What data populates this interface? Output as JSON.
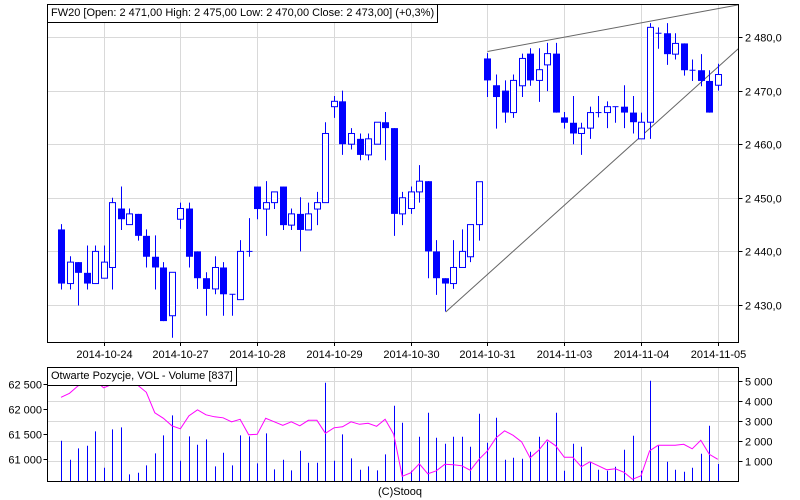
{
  "header": {
    "title": "FW20 [Open: 2 471,00  High: 2 475,00  Low: 2 470,00  Close: 2 473,00] (+0,3%)"
  },
  "volume_panel": {
    "title": "Otwarte Pozycje, VOL - Volume [837]"
  },
  "footer": {
    "copyright": "(C)Stooq"
  },
  "colors": {
    "candle": "#0000ff",
    "open_interest": "#ff00ff",
    "grid": "#d9d9d9",
    "trendline": "#666666"
  },
  "chart_data": [
    {
      "type": "candlestick",
      "title": "FW20",
      "y_axis": {
        "position": "right",
        "range": [
          2423,
          2486
        ],
        "ticks": [
          2430,
          2440,
          2450,
          2460,
          2470,
          2480
        ],
        "tick_labels": [
          "2 430,0",
          "2 440,0",
          "2 450,0",
          "2 460,0",
          "2 470,0",
          "2 480,0"
        ]
      },
      "x_axis": {
        "date_labels": [
          {
            "index": 5,
            "label": "2014-10-24"
          },
          {
            "index": 14,
            "label": "2014-10-27"
          },
          {
            "index": 23,
            "label": "2014-10-28"
          },
          {
            "index": 32,
            "label": "2014-10-29"
          },
          {
            "index": 41,
            "label": "2014-10-30"
          },
          {
            "index": 50,
            "label": "2014-10-31"
          },
          {
            "index": 59,
            "label": "2014-11-03"
          },
          {
            "index": 68,
            "label": "2014-11-04"
          },
          {
            "index": 77,
            "label": "2014-11-05"
          }
        ]
      },
      "grid": true,
      "ohlc_fields": [
        "open",
        "high",
        "low",
        "close"
      ],
      "ohlc": [
        [
          2444.1,
          2445.1,
          2432.9,
          2434
        ],
        [
          2434,
          2439.1,
          2432.9,
          2438
        ],
        [
          2438,
          2438,
          2429.9,
          2436
        ],
        [
          2436,
          2441.1,
          2432.9,
          2434
        ],
        [
          2434,
          2441.1,
          2434,
          2440
        ],
        [
          2435,
          2441.1,
          2435,
          2438
        ],
        [
          2437,
          2450,
          2432.9,
          2449.1
        ],
        [
          2448,
          2452.1,
          2444,
          2446
        ],
        [
          2445,
          2448,
          2445,
          2447
        ],
        [
          2447,
          2447,
          2442,
          2442.9
        ],
        [
          2442.9,
          2444.1,
          2437,
          2439
        ],
        [
          2439,
          2443,
          2432.9,
          2437
        ],
        [
          2437,
          2438,
          2427,
          2427
        ],
        [
          2428,
          2436.1,
          2423.9,
          2436.1
        ],
        [
          2446,
          2449.1,
          2444.2,
          2448
        ],
        [
          2448,
          2449.1,
          2437,
          2439
        ],
        [
          2440,
          2440,
          2433,
          2435
        ],
        [
          2435,
          2436.1,
          2428,
          2433
        ],
        [
          2433,
          2439.1,
          2432,
          2437
        ],
        [
          2437,
          2438,
          2428,
          2432
        ],
        [
          2432,
          2432,
          2428,
          2432
        ],
        [
          2431,
          2442.1,
          2431,
          2440
        ],
        [
          2440,
          2446.2,
          2439,
          2440
        ],
        [
          2452.1,
          2452.1,
          2446,
          2447.9
        ],
        [
          2447.9,
          2453.1,
          2442.9,
          2449.1
        ],
        [
          2449.1,
          2451.1,
          2447.9,
          2451.1
        ],
        [
          2452.1,
          2452.1,
          2444,
          2444.9
        ],
        [
          2444.9,
          2448,
          2444,
          2447
        ],
        [
          2447,
          2450.1,
          2440,
          2444
        ],
        [
          2444,
          2449.1,
          2444,
          2447
        ],
        [
          2447.9,
          2451.1,
          2444.9,
          2449.1
        ],
        [
          2449.1,
          2464.1,
          2449.1,
          2462
        ],
        [
          2467,
          2469,
          2464.9,
          2468
        ],
        [
          2468,
          2470,
          2458,
          2460
        ],
        [
          2460,
          2463,
          2459,
          2462
        ],
        [
          2461,
          2462,
          2457,
          2458
        ],
        [
          2458,
          2462,
          2457,
          2461
        ],
        [
          2460,
          2464.1,
          2460,
          2464.1
        ],
        [
          2464.1,
          2466,
          2457,
          2463
        ],
        [
          2463,
          2463,
          2442.9,
          2447
        ],
        [
          2447,
          2451.1,
          2444.9,
          2450
        ],
        [
          2448,
          2452.1,
          2447,
          2451.1
        ],
        [
          2451.1,
          2456.1,
          2449.1,
          2453.1
        ],
        [
          2453.1,
          2453.1,
          2435,
          2440
        ],
        [
          2440,
          2442.1,
          2431.9,
          2435
        ],
        [
          2435,
          2435,
          2428.8,
          2434
        ],
        [
          2434,
          2442.1,
          2433,
          2437
        ],
        [
          2437,
          2444.1,
          2437,
          2440
        ],
        [
          2439,
          2445,
          2438,
          2445
        ],
        [
          2445,
          2453,
          2442,
          2453
        ],
        [
          2476,
          2477,
          2468.8,
          2471.9
        ],
        [
          2471,
          2473,
          2462.9,
          2468.8
        ],
        [
          2470,
          2471.9,
          2464,
          2465.9
        ],
        [
          2465.9,
          2473,
          2464.9,
          2471.9
        ],
        [
          2470.9,
          2476.9,
          2468.8,
          2476
        ],
        [
          2476.9,
          2477.9,
          2470.9,
          2471.9
        ],
        [
          2471.9,
          2477.9,
          2467.9,
          2473.9
        ],
        [
          2474.8,
          2478.9,
          2469.9,
          2476.9
        ],
        [
          2476.9,
          2478.9,
          2465.9,
          2465.9
        ],
        [
          2465,
          2466,
          2462.9,
          2464
        ],
        [
          2464,
          2469,
          2460,
          2462
        ],
        [
          2462,
          2464,
          2458,
          2463
        ],
        [
          2463,
          2467,
          2461,
          2465.9
        ],
        [
          2465.9,
          2469,
          2465,
          2465.9
        ],
        [
          2465.9,
          2468,
          2463,
          2467
        ],
        [
          2467,
          2467,
          2464,
          2467
        ],
        [
          2467,
          2471,
          2463,
          2465.9
        ],
        [
          2465.9,
          2469,
          2462,
          2464.1
        ],
        [
          2461,
          2465.9,
          2461,
          2464.1
        ],
        [
          2464.1,
          2482.6,
          2461,
          2481.8
        ],
        [
          2480.7,
          2481.8,
          2477.8,
          2480.7
        ],
        [
          2480.7,
          2482.6,
          2474.8,
          2476.8
        ],
        [
          2476.8,
          2480.7,
          2475.8,
          2478.8
        ],
        [
          2478.8,
          2478.8,
          2472.8,
          2473.8
        ],
        [
          2473.8,
          2475.8,
          2471.8,
          2473.8
        ],
        [
          2473.8,
          2476.8,
          2470.8,
          2471.8
        ],
        [
          2471.8,
          2473.8,
          2465.9,
          2465.9
        ],
        [
          2471,
          2475,
          2470,
          2473
        ]
      ],
      "trendlines": [
        {
          "name": "upper-trendline",
          "from": [
            50,
            2477.3
          ],
          "to": [
            79.4,
            2486
          ]
        },
        {
          "name": "lower-trendline",
          "from": [
            45.1,
            2428.7
          ],
          "to": [
            79.4,
            2477.8
          ]
        }
      ]
    },
    {
      "type": "bar+line",
      "title": "Otwarte Pozycje, VOL - Volume [837]",
      "volume_axis": {
        "position": "right",
        "range": [
          0,
          5200
        ],
        "ticks": [
          1000,
          2000,
          3000,
          4000,
          5000
        ],
        "tick_labels": [
          "1 000",
          "2 000",
          "3 000",
          "4 000",
          "5 000"
        ]
      },
      "open_interest_axis": {
        "position": "left",
        "ticks": [
          61000,
          61500,
          62000,
          62500
        ],
        "tick_labels": [
          "61 000",
          "61 500",
          "62 000",
          "62 500"
        ]
      },
      "volume": [
        2000,
        1050,
        1617,
        1750,
        2467,
        650,
        2567,
        2667,
        317,
        400,
        767,
        1367,
        2267,
        3267,
        1000,
        2217,
        1800,
        2067,
        717,
        1400,
        767,
        2267,
        2217,
        867,
        2367,
        567,
        1050,
        517,
        1500,
        900,
        900,
        4900,
        1000,
        2317,
        1117,
        550,
        717,
        517,
        1317,
        3750,
        2900,
        500,
        2200,
        3400,
        2150,
        1850,
        2200,
        2200,
        1700,
        3350,
        1900,
        3150,
        1050,
        1150,
        1100,
        1450,
        2200,
        1950,
        3400,
        500,
        1850,
        1700,
        950,
        550,
        500,
        700,
        1550,
        2250,
        500,
        5000,
        1750,
        950,
        550,
        450,
        650,
        1350,
        2750,
        837
      ],
      "open_interest": [
        62240,
        62320,
        62470,
        62500,
        62570,
        62430,
        62500,
        62480,
        62500,
        62480,
        62340,
        61930,
        61820,
        61670,
        61610,
        61870,
        61990,
        61890,
        61850,
        61830,
        61750,
        61800,
        61490,
        61500,
        61820,
        61750,
        61680,
        61750,
        61670,
        61780,
        61780,
        61520,
        61630,
        61650,
        61750,
        61700,
        61720,
        61660,
        61800,
        61500,
        60660,
        60730,
        60910,
        60710,
        60770,
        60900,
        60890,
        60870,
        60780,
        61000,
        61170,
        61430,
        61570,
        61480,
        61350,
        61030,
        61180,
        61390,
        61270,
        61040,
        61040,
        60850,
        60950,
        60870,
        60790,
        60810,
        60740,
        60600,
        60670,
        61170,
        61280,
        61280,
        61280,
        61300,
        61210,
        61380,
        61100,
        61000
      ]
    }
  ]
}
